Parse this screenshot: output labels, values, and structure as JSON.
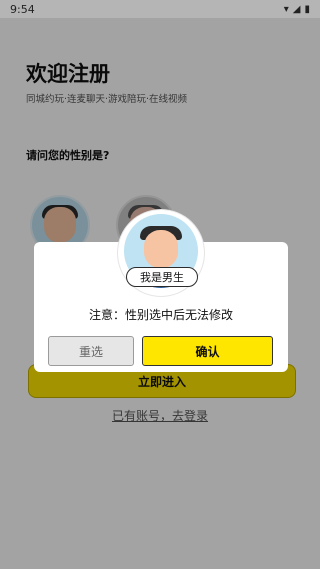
{
  "status_bar": {
    "time": "9:54",
    "icons": [
      "wifi-icon",
      "signal-icon",
      "battery-icon"
    ]
  },
  "main": {
    "title": "欢迎注册",
    "subtitle": "同城约玩·连麦聊天·游戏陪玩·在线视频",
    "question": "请问您的性别是?",
    "enter_button": "立即进入",
    "login_link": "已有账号，去登录"
  },
  "dialog": {
    "tag": "我是男生",
    "note": "注意：性别选中后无法修改",
    "reselect_button": "重选",
    "confirm_button": "确认"
  },
  "colors": {
    "accent": "#ffe600",
    "avatar_bg": "#bfe3f2"
  }
}
